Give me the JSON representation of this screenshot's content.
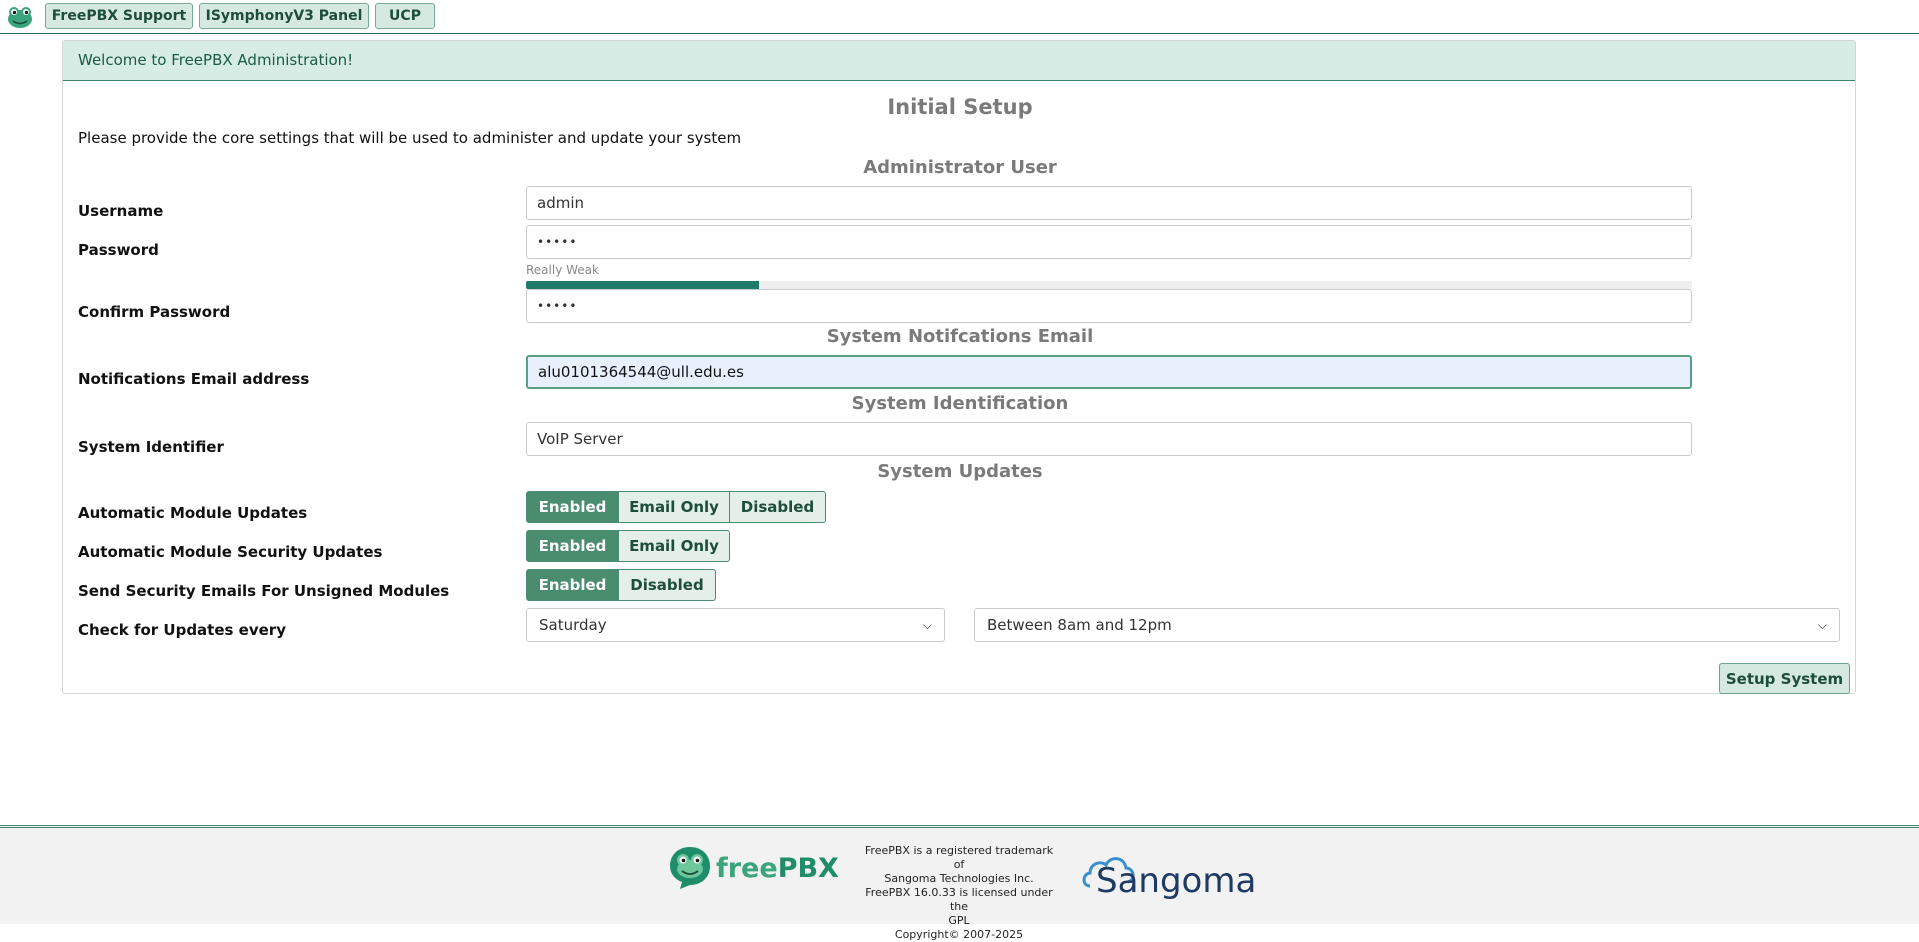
{
  "nav": {
    "buttons": [
      "FreePBX Support",
      "ISymphonyV3 Panel",
      "UCP"
    ]
  },
  "panel": {
    "header": "Welcome to FreePBX Administration!",
    "title": "Initial Setup",
    "intro": "Please provide the core settings that will be used to administer and update your system"
  },
  "admin": {
    "section": "Administrator User",
    "username_label": "Username",
    "username_value": "admin",
    "password_label": "Password",
    "password_value": "•••••",
    "strength": "Really Weak",
    "strength_fraction": 0.2,
    "confirm_label": "Confirm Password",
    "confirm_value": "•••••"
  },
  "email": {
    "section": "System Notifcations Email",
    "label": "Notifications Email address",
    "value": "alu0101364544@ull.edu.es"
  },
  "ident": {
    "section": "System Identification",
    "label": "System Identifier",
    "value": "VoIP Server"
  },
  "updates": {
    "section": "System Updates",
    "module_label": "Automatic Module Updates",
    "module_options": [
      "Enabled",
      "Email Only",
      "Disabled"
    ],
    "module_selected": "Enabled",
    "security_label": "Automatic Module Security Updates",
    "security_options": [
      "Enabled",
      "Email Only"
    ],
    "security_selected": "Enabled",
    "unsigned_label": "Send Security Emails For Unsigned Modules",
    "unsigned_options": [
      "Enabled",
      "Disabled"
    ],
    "unsigned_selected": "Enabled",
    "check_label": "Check for Updates every",
    "day": "Saturday",
    "time": "Between 8am and 12pm"
  },
  "actions": {
    "setup": "Setup System"
  },
  "footer": {
    "brand_free": "free",
    "brand_pbx": "PBX",
    "legal": [
      "FreePBX is a registered trademark of",
      "Sangoma Technologies Inc.",
      "FreePBX 16.0.33 is licensed under the",
      "GPL",
      "Copyright© 2007-2025"
    ],
    "partner": "Sangoma"
  },
  "colors": {
    "accent": "#4a8d6e",
    "header_bg": "#d8ece6",
    "strength_fill": "#1f7a6b"
  }
}
